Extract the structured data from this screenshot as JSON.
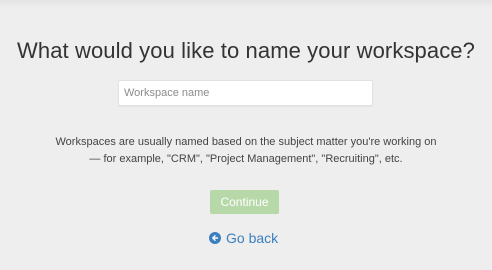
{
  "page": {
    "title": "What would you like to name your workspace?"
  },
  "form": {
    "workspace_name": {
      "value": "",
      "placeholder": "Workspace name"
    }
  },
  "help": {
    "line1": "Workspaces are usually named based on the subject matter you're working on",
    "line2": "— for example, \"CRM\", \"Project Management\", \"Recruiting\", etc."
  },
  "actions": {
    "continue_label": "Continue",
    "go_back_label": "Go back",
    "go_back_icon": "arrow-left-circle-icon"
  },
  "colors": {
    "background": "#eeeeee",
    "continue_button": "#b7d8a9",
    "link": "#3a7fc0"
  }
}
